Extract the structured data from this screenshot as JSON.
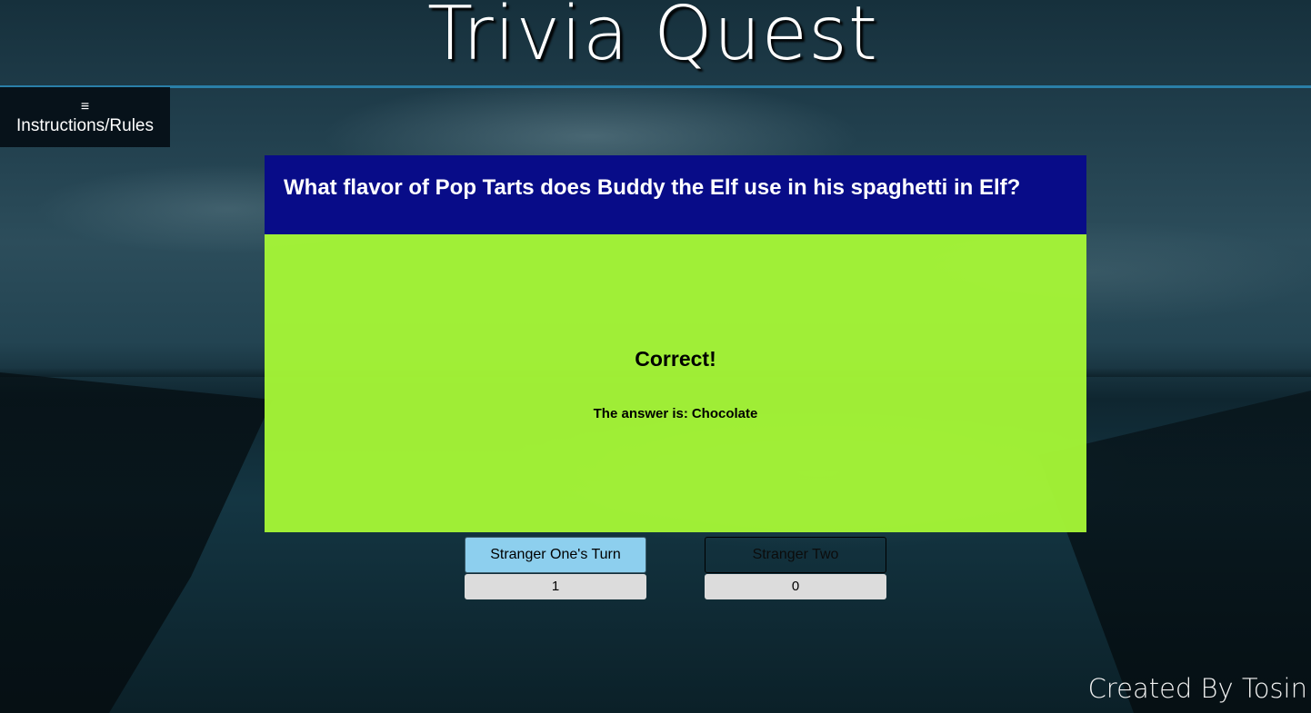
{
  "app": {
    "title": "Trivia Quest",
    "credit": "Created By Tosin"
  },
  "menu": {
    "icon": "hamburger-icon",
    "icon_glyph": "≡",
    "label": "Instructions/Rules"
  },
  "question": {
    "text": "What flavor of Pop Tarts does Buddy the Elf use in his spaghetti in Elf?"
  },
  "result": {
    "title": "Correct!",
    "answer_prefix": "The answer is:",
    "answer_value": "Chocolate"
  },
  "players": [
    {
      "label": "Stranger One's Turn",
      "score": "1",
      "active": true
    },
    {
      "label": "Stranger Two",
      "score": "0",
      "active": false
    }
  ],
  "colors": {
    "question_bg": "#080c88",
    "result_bg": "#a5f636",
    "active_player_bg": "#8dcfee",
    "header_rule": "#2a7fa8"
  }
}
